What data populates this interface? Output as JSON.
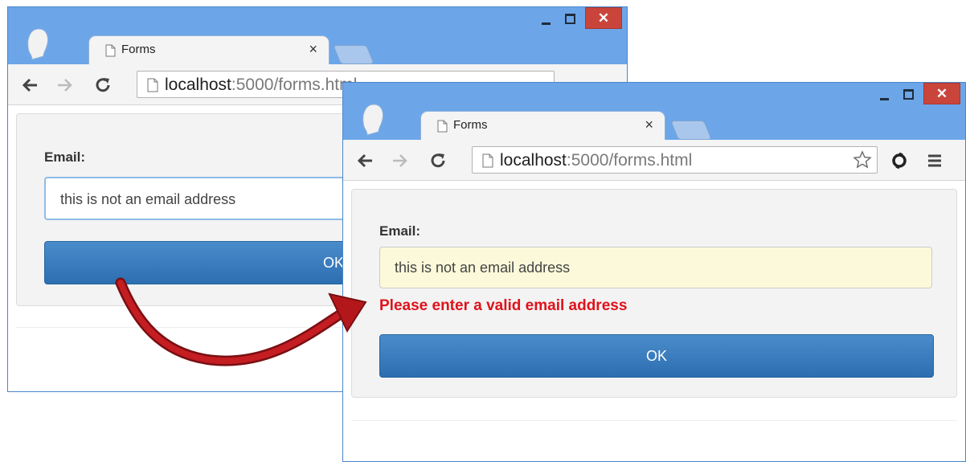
{
  "colors": {
    "window_frame": "#6ca6e9",
    "close_button": "#c9453b",
    "button_blue": "#2c6eb0",
    "error_red": "#e0121b",
    "invalid_input_bg": "#fbf9d9",
    "arrow_red": "#b4171b"
  },
  "window_before": {
    "tab_title": "Forms",
    "url_host": "localhost",
    "url_rest": ":5000/forms.html",
    "email_label": "Email:",
    "email_value": "this is not an email address",
    "ok_label": "OK"
  },
  "window_after": {
    "tab_title": "Forms",
    "url_host": "localhost",
    "url_rest": ":5000/forms.html",
    "email_label": "Email:",
    "email_value": "this is not an email address",
    "error_message": "Please enter a valid email address",
    "ok_label": "OK"
  },
  "icons": [
    "user-avatar-icon",
    "document-icon",
    "close-icon",
    "new-tab-icon",
    "minimize-icon",
    "maximize-icon",
    "back-icon",
    "forward-icon",
    "reload-icon",
    "star-icon",
    "extension-icon",
    "menu-icon",
    "curved-arrow-icon"
  ]
}
